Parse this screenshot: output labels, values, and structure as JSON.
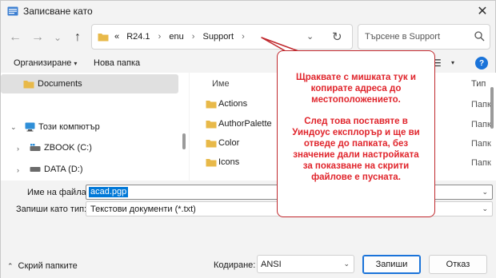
{
  "window": {
    "title": "Записване като",
    "close_glyph": "✕"
  },
  "addressbar": {
    "overflow": "«",
    "path": [
      "R24.1",
      "enu",
      "Support"
    ],
    "separator": "›",
    "chevron": "⌄",
    "refresh_glyph": "↻"
  },
  "search": {
    "placeholder": "Търсене в Support"
  },
  "nav_buttons": {
    "back": "←",
    "forward": "→",
    "recent": "⌄",
    "up": "↑"
  },
  "commandbar": {
    "organize": "Организиране",
    "organize_caret": "▾",
    "new_folder": "Нова папка",
    "view_glyph": "☰",
    "view_caret": "▾",
    "help": "?"
  },
  "navpane": {
    "items": [
      {
        "label": "Documents",
        "icon": "folder-icon"
      },
      {
        "label": "Този компютър",
        "icon": "computer-icon",
        "expander": "⌄"
      },
      {
        "label": "ZBOOK (C:)",
        "icon": "drive-icon",
        "expander": "›"
      },
      {
        "label": "DATA (D:)",
        "icon": "drive-icon",
        "expander": "›"
      }
    ]
  },
  "filelist": {
    "columns": {
      "name": "Име",
      "type": "Тип"
    },
    "rows": [
      {
        "name": "Actions",
        "type": "Папк"
      },
      {
        "name": "AuthorPalette",
        "type": "Папк"
      },
      {
        "name": "Color",
        "type": "Папк"
      },
      {
        "name": "Icons",
        "type": "Папк"
      }
    ]
  },
  "form": {
    "filename_label": "Име на файла:",
    "filename_value": "acad.pgp",
    "filetype_label": "Запиши като тип:",
    "filetype_value": "Текстови документи (*.txt)",
    "dropdown_caret": "⌄"
  },
  "footer": {
    "hide_folders": "Скрий папките",
    "hide_caret": "⌃",
    "encoding_label": "Кодиране:",
    "encoding_value": "ANSI",
    "save": "Запиши",
    "cancel": "Отказ"
  },
  "callout": {
    "line1": "Щраквате с мишката тук и",
    "line2": "копирате адреса до",
    "line3": "местоположението.",
    "line4": "След това поставяте в",
    "line5": "Уиндоус експлорър и ще ви",
    "line6": "отведе до папката, без",
    "line7": "значение дали настройката",
    "line8": "за показване на скрити",
    "line9": "файлове е пусната."
  },
  "colors": {
    "accent": "#1a73d9",
    "folder": "#e8b949",
    "callout_text": "#e0242b",
    "callout_border": "#c0282d"
  }
}
